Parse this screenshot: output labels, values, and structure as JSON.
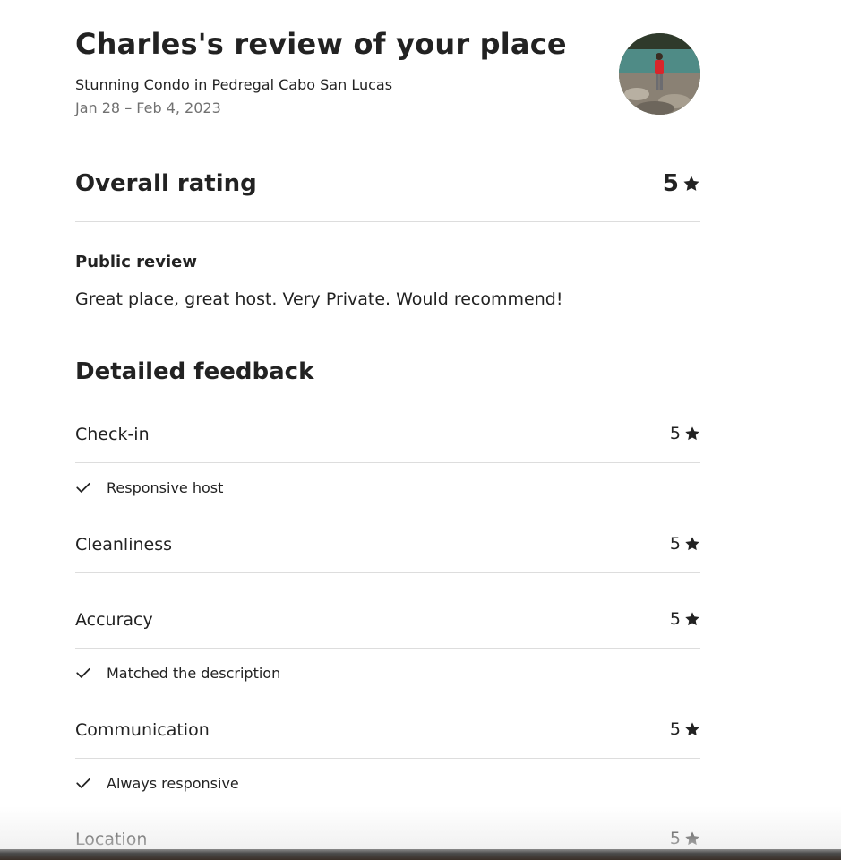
{
  "header": {
    "title": "Charles's review of your place",
    "listing_name": "Stunning Condo in Pedregal Cabo San Lucas",
    "dates": "Jan 28 – Feb 4, 2023"
  },
  "overall": {
    "label": "Overall rating",
    "score": "5",
    "icon": "star-icon"
  },
  "public_review": {
    "heading": "Public review",
    "text": "Great place, great host. Very Private. Would recommend!"
  },
  "detailed_feedback": {
    "heading": "Detailed feedback",
    "categories": [
      {
        "label": "Check-in",
        "score": "5",
        "tags": [
          "Responsive host"
        ]
      },
      {
        "label": "Cleanliness",
        "score": "5",
        "tags": []
      },
      {
        "label": "Accuracy",
        "score": "5",
        "tags": [
          "Matched the description"
        ]
      },
      {
        "label": "Communication",
        "score": "5",
        "tags": [
          "Always responsive"
        ]
      },
      {
        "label": "Location",
        "score": "5",
        "tags": []
      }
    ]
  },
  "colors": {
    "text_primary": "#222222",
    "text_secondary": "#717171",
    "divider": "#dddddd"
  }
}
